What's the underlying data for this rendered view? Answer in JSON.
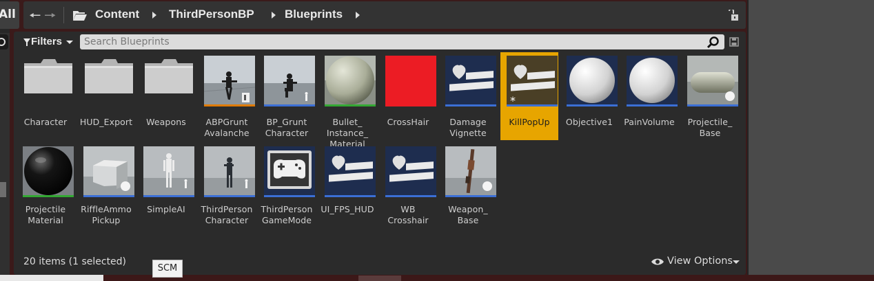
{
  "app": {
    "left_tab_label": "All",
    "path": [
      "Content",
      "ThirdPersonBP",
      "Blueprints"
    ]
  },
  "toolbar": {
    "filters_label": "Filters",
    "search_placeholder": "Search Blueprints"
  },
  "assets": [
    {
      "label": "Character",
      "icon": "folder-icon",
      "bar_color": ""
    },
    {
      "label": "HUD_Export",
      "icon": "folder-icon",
      "bar_color": ""
    },
    {
      "label": "Weapons",
      "icon": "folder-icon",
      "bar_color": ""
    },
    {
      "label": "ABPGrunt\nAvalanche",
      "icon": "mannequin-rifle-thumbnail",
      "bar_color": "#e07a00"
    },
    {
      "label": "BP_Grunt\nCharacter",
      "icon": "mannequin-kneel-thumbnail",
      "bar_color": "#3b6fd6"
    },
    {
      "label": "Bullet_\nInstance_\nMaterial",
      "icon": "material-sphere-thumbnail",
      "bar_color": "#33a833"
    },
    {
      "label": "CrossHair",
      "icon": "red-texture-thumbnail",
      "bar_color": ""
    },
    {
      "label": "Damage\nVignette",
      "icon": "widget-blueprint-icon",
      "bar_color": "#3b6fd6"
    },
    {
      "label": "KillPopUp",
      "icon": "widget-blueprint-icon",
      "bar_color": "#3b6fd6",
      "selected": true
    },
    {
      "label": "Objective1",
      "icon": "white-sphere-thumbnail",
      "bar_color": "#3b6fd6"
    },
    {
      "label": "PainVolume",
      "icon": "white-sphere-thumbnail",
      "bar_color": "#3b6fd6"
    },
    {
      "label": "Projectile_\nBase",
      "icon": "capsule-thumbnail",
      "bar_color": "#3b6fd6"
    },
    {
      "label": "Projectile\nMaterial",
      "icon": "black-sphere-thumbnail",
      "bar_color": "#33a833"
    },
    {
      "label": "RiffleAmmo\nPickup",
      "icon": "box-thumbnail",
      "bar_color": "#3b6fd6"
    },
    {
      "label": "SimpleAI",
      "icon": "mannequin-standing-thumbnail",
      "bar_color": "#3b6fd6"
    },
    {
      "label": "ThirdPerson\nCharacter",
      "icon": "mannequin-dark-thumbnail",
      "bar_color": "#3b6fd6"
    },
    {
      "label": "ThirdPerson\nGameMode",
      "icon": "gamepad-icon",
      "bar_color": "#3b6fd6"
    },
    {
      "label": "UI_FPS_HUD",
      "icon": "widget-blueprint-icon",
      "bar_color": "#3b6fd6"
    },
    {
      "label": "WB\nCrosshair",
      "icon": "widget-blueprint-icon",
      "bar_color": "#3b6fd6"
    },
    {
      "label": "Weapon_\nBase",
      "icon": "rifle-thumbnail",
      "bar_color": "#3b6fd6"
    }
  ],
  "status": {
    "item_count": "20 items (1 selected)",
    "tooltip": "SCM",
    "view_options_label": "View Options"
  },
  "colors": {
    "selection": "#e7a500",
    "blueprint_bar": "#3b6fd6",
    "material_bar": "#33a833",
    "anim_bar": "#e07a00"
  }
}
